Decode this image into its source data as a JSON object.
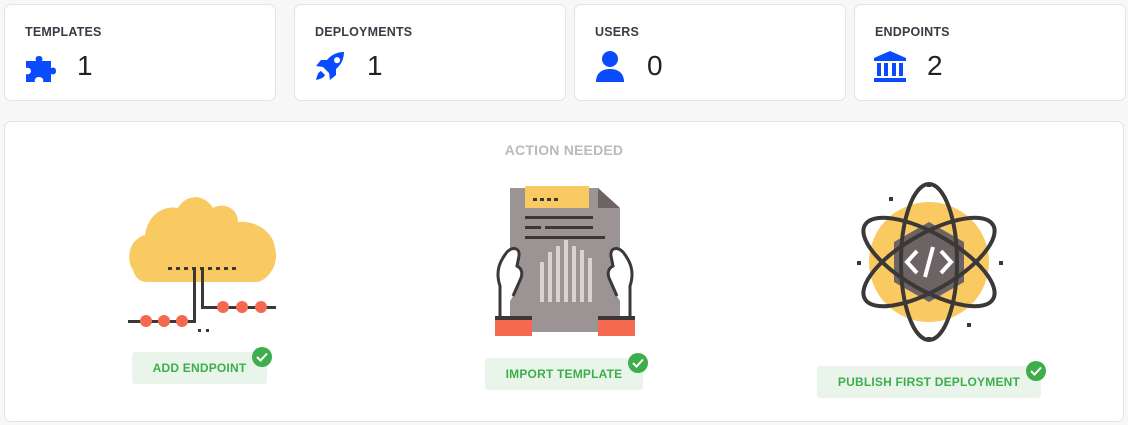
{
  "stats": [
    {
      "label": "TEMPLATES",
      "value": "1",
      "icon": "puzzle-icon"
    },
    {
      "label": "DEPLOYMENTS",
      "value": "1",
      "icon": "rocket-icon"
    },
    {
      "label": "USERS",
      "value": "0",
      "icon": "user-icon"
    },
    {
      "label": "ENDPOINTS",
      "value": "2",
      "icon": "bank-icon"
    }
  ],
  "action_panel": {
    "title": "ACTION NEEDED",
    "actions": [
      {
        "label": "ADD ENDPOINT",
        "done": true,
        "illustration": "cloud-network-icon"
      },
      {
        "label": "IMPORT TEMPLATE",
        "done": true,
        "illustration": "document-hands-icon"
      },
      {
        "label": "PUBLISH FIRST DEPLOYMENT",
        "done": true,
        "illustration": "atom-code-icon"
      }
    ]
  },
  "colors": {
    "accent": "#0a4bff",
    "success": "#3dae4b",
    "cloud": "#f9c962",
    "node": "#f4694f"
  }
}
